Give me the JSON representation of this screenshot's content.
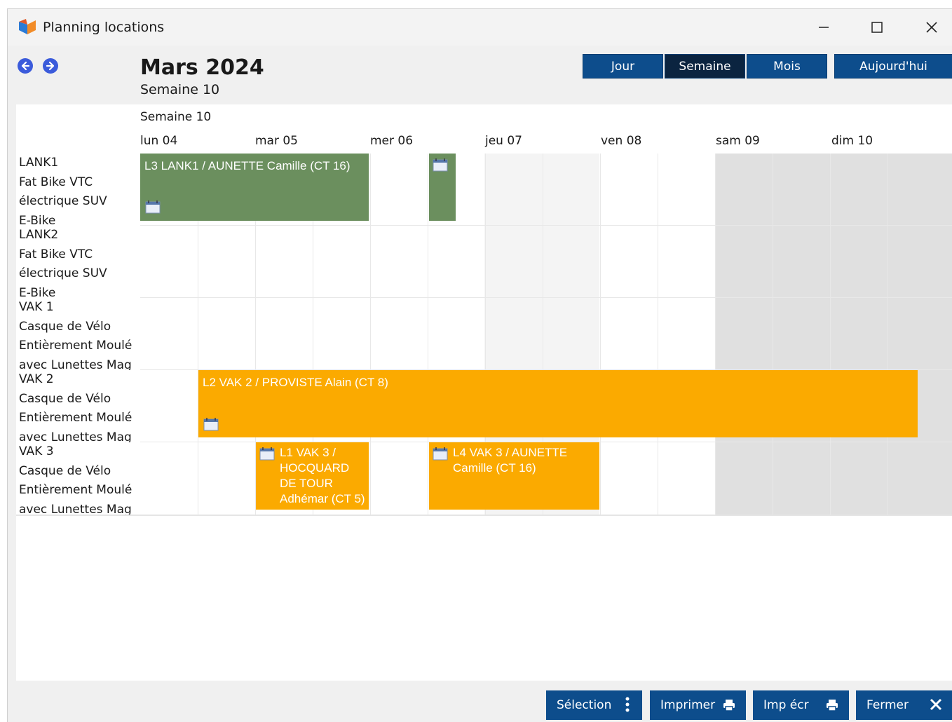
{
  "window": {
    "title": "Planning locations"
  },
  "header": {
    "month": "Mars 2024",
    "week": "Semaine 10"
  },
  "views": {
    "day": "Jour",
    "week": "Semaine",
    "month": "Mois",
    "today": "Aujourd'hui",
    "active": "Semaine"
  },
  "calendar": {
    "week_label": "Semaine 10",
    "days": [
      "lun 04",
      "mar 05",
      "mer 06",
      "jeu 07",
      "ven 08",
      "sam 09",
      "dim 10"
    ],
    "resources": [
      {
        "lines": [
          "LANK1",
          "Fat Bike VTC",
          "électrique SUV",
          "E-Bike"
        ]
      },
      {
        "lines": [
          "LANK2",
          "Fat Bike VTC",
          "électrique SUV",
          "E-Bike"
        ]
      },
      {
        "lines": [
          "VAK 1",
          "Casque de Vélo",
          "Entièrement Moulé",
          "avec Lunettes Mag"
        ]
      },
      {
        "lines": [
          "VAK 2",
          "Casque de Vélo",
          "Entièrement Moulé",
          "avec Lunettes Mag"
        ]
      },
      {
        "lines": [
          "VAK 3",
          "Casque de Vélo",
          "Entièrement Moulé",
          "avec Lunettes Mag"
        ]
      }
    ],
    "events": [
      {
        "id": "L3",
        "text": "L3 LANK1 / AUNETTE Camille (CT 16)"
      },
      {
        "id": "L2",
        "text": "L2 VAK 2 / PROVISTE Alain (CT 8)"
      },
      {
        "id": "L1",
        "text": "L1 VAK 3 / HOCQUARD DE TOUR Adhémar (CT 5)"
      },
      {
        "id": "L4",
        "text": "L4 VAK 3 / AUNETTE Camille (CT 16)"
      }
    ]
  },
  "colors": {
    "primary_button": "#0d4d8c",
    "active_button": "#0b2440",
    "event_green": "#6b8f5e",
    "event_orange": "#fbaa00",
    "weekend_bg": "#e0e0e0"
  },
  "footer": {
    "selection": "Sélection",
    "print": "Imprimer",
    "print_screen": "Imp écr",
    "close": "Fermer"
  }
}
